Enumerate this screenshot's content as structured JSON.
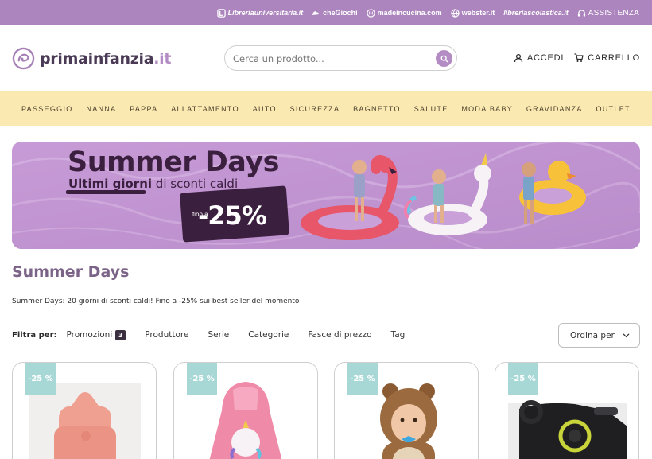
{
  "topbar": {
    "links": [
      {
        "label": "Libreriauniversitaria.it",
        "icon": "book-icon"
      },
      {
        "label": "cheGiochi",
        "icon": "cloud-icon"
      },
      {
        "label": "madeincucina.com",
        "icon": "whisk-icon"
      },
      {
        "label": "webster.it",
        "icon": "globe-icon"
      },
      {
        "label": "libreriascolastica.it",
        "icon": ""
      },
      {
        "label": "ASSISTENZA",
        "icon": "headset-icon"
      }
    ]
  },
  "header": {
    "logo_main": "primainfanzia",
    "logo_tld": ".it",
    "search_placeholder": "Cerca un prodotto...",
    "login_label": "ACCEDI",
    "cart_label": "CARRELLO"
  },
  "categories": [
    "PASSEGGIO",
    "NANNA",
    "PAPPA",
    "ALLATTAMENTO",
    "AUTO",
    "SICUREZZA",
    "BAGNETTO",
    "SALUTE",
    "MODA BABY",
    "GRAVIDANZA",
    "OUTLET"
  ],
  "banner": {
    "title": "Summer Days",
    "subtitle_bold": "Ultimi giorni",
    "subtitle_rest": " di sconti caldi",
    "fino": "fino a",
    "discount": "-25%"
  },
  "page": {
    "title": "Summer Days",
    "description": "Summer Days: 20 giorni di sconti caldi! Fino a -25% sui best seller del momento"
  },
  "filters": {
    "label": "Filtra per:",
    "items": [
      {
        "label": "Promozioni",
        "count": "3"
      },
      {
        "label": "Produttore",
        "count": ""
      },
      {
        "label": "Serie",
        "count": ""
      },
      {
        "label": "Categorie",
        "count": ""
      },
      {
        "label": "Fasce di prezzo",
        "count": ""
      },
      {
        "label": "Tag",
        "count": ""
      }
    ],
    "sort_label": "Ordina per"
  },
  "products": [
    {
      "badge": "-25 %",
      "image": "sippy-cup"
    },
    {
      "badge": "-25 %",
      "image": "unicorn-poncho"
    },
    {
      "badge": "-25 %",
      "image": "bear-costume-baby"
    },
    {
      "badge": "-25 %",
      "image": "car-seat-base"
    }
  ],
  "colors": {
    "topbar": "#ad85be",
    "accent": "#b48cc4",
    "nav_bg": "#fbe9b2",
    "title": "#7c6488",
    "badge": "#a8d8d6"
  }
}
